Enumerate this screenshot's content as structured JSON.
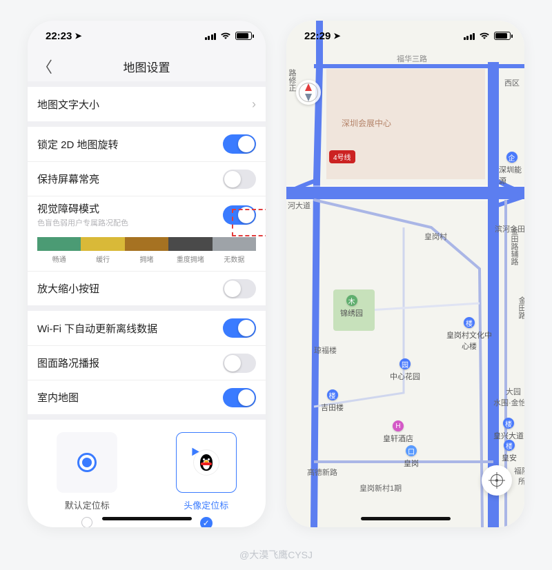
{
  "left": {
    "status_time": "22:23",
    "page_title": "地图设置",
    "rows": {
      "text_size": "地图文字大小",
      "lock_2d": "锁定 2D 地图旋转",
      "keep_screen": "保持屏幕常亮",
      "vision_mode": "视觉障碍模式",
      "vision_sub": "色盲色弱用户专属路况配色",
      "zoom_btn": "放大缩小按钮",
      "wifi_offline": "Wi-Fi 下自动更新离线数据",
      "traffic_voice": "图面路况播报",
      "indoor_map": "室内地图"
    },
    "toggles": {
      "lock_2d": true,
      "keep_screen": false,
      "vision_mode": true,
      "zoom_btn": false,
      "wifi_offline": true,
      "traffic_voice": false,
      "indoor_map": true
    },
    "legend": {
      "colors": [
        "#4b9b74",
        "#d9b938",
        "#a67222",
        "#4a4a4a",
        "#9ea3a8"
      ],
      "labels": [
        "畅通",
        "缓行",
        "拥堵",
        "重度拥堵",
        "无数据"
      ]
    },
    "marker": {
      "default_label": "默认定位标",
      "avatar_label": "头像定位标",
      "selected": "avatar"
    }
  },
  "right": {
    "status_time": "22:29",
    "metro_line": "4号线",
    "labels": {
      "fuhua3": "福华三路",
      "xiqu": "西区",
      "exhibit": "深圳会展中心",
      "energy": "深圳能源",
      "hedadao": "河大道",
      "binhejintian": "滨河金田立",
      "jintian_aux": "金田路辅路",
      "jintian": "金田路",
      "luxiu": "路修正",
      "huanggang_village": "皇岗村",
      "jinxiuyuan": "锦绣园",
      "huanggang_culture": "皇岗村文化中心楼",
      "qifulou": "琼福楼",
      "zhongxin_garden": "中心花园",
      "jitianlou": "吉田楼",
      "dayuan": "大园",
      "shuiwei": "水围·金怡",
      "huangxuan_hotel": "皇轩酒店",
      "huangxing": "皇兴大道",
      "huanggang": "皇岗",
      "huangan": "皇安",
      "fuyuan": "福院",
      "suo": "所",
      "gaodexinlu": "高德新路",
      "huanggang_xincun": "皇岗新村1期"
    }
  },
  "watermark": "@大漠飞鹰CYSJ"
}
